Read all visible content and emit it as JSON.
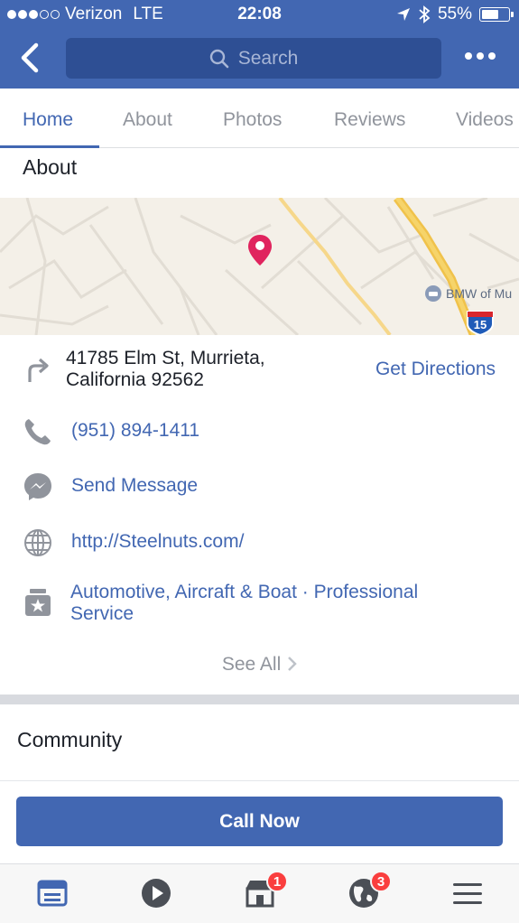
{
  "status_bar": {
    "carrier": "Verizon",
    "network": "LTE",
    "time": "22:08",
    "battery": "55%"
  },
  "header": {
    "search_placeholder": "Search"
  },
  "tabs": [
    {
      "label": "Home",
      "active": true
    },
    {
      "label": "About",
      "active": false
    },
    {
      "label": "Photos",
      "active": false
    },
    {
      "label": "Reviews",
      "active": false
    },
    {
      "label": "Videos",
      "active": false
    }
  ],
  "about": {
    "title": "About",
    "map": {
      "poi_label": "BMW of Mu",
      "highway_shield": "15"
    },
    "address_line1": "41785 Elm St, Murrieta,",
    "address_line2": "California 92562",
    "directions_label": "Get Directions",
    "phone": "(951) 894-1411",
    "message_label": "Send Message",
    "website": "http://Steelnuts.com/",
    "category_line1": "Automotive, Aircraft & Boat · Professional",
    "category_line2": "Service",
    "see_all_label": "See All"
  },
  "community": {
    "title": "Community"
  },
  "call_now_label": "Call Now",
  "bottom_nav": {
    "marketplace_badge": "1",
    "notifications_badge": "3"
  },
  "colors": {
    "brand": "#4267b2",
    "badge": "#fa3e3e",
    "pin": "#e0245e"
  }
}
